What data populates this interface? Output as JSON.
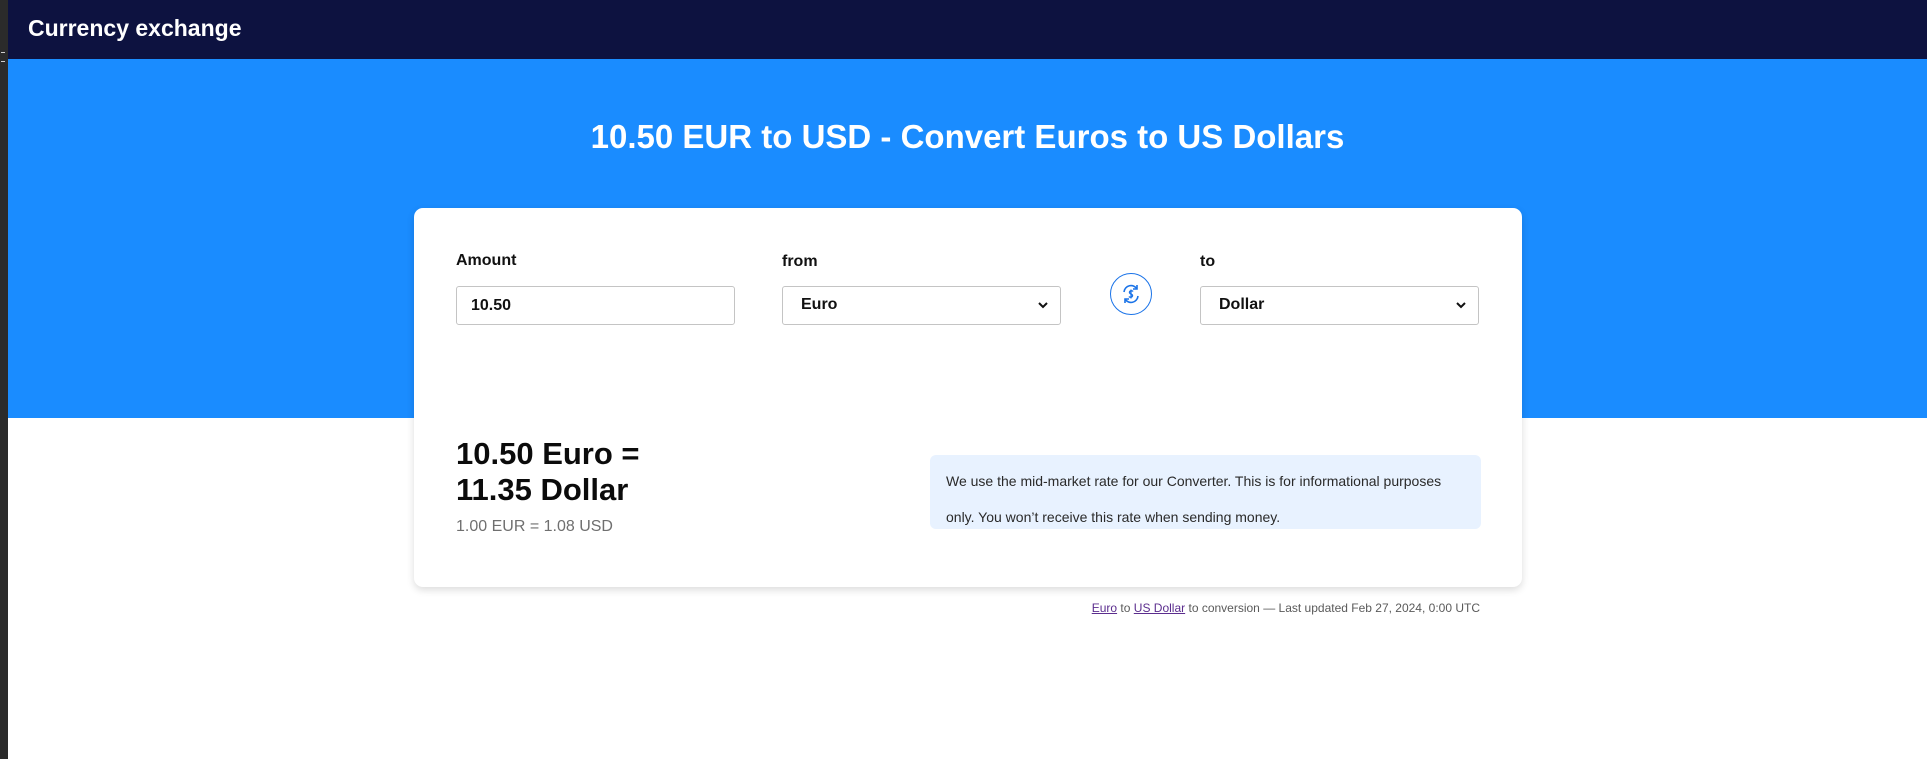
{
  "header": {
    "brand": "Currency exchange"
  },
  "hero": {
    "headline": "10.50 EUR to USD - Convert Euros to US Dollars"
  },
  "converter": {
    "amount_label": "Amount",
    "amount_value": "10.50",
    "from_label": "from",
    "from_value": "Euro",
    "to_label": "to",
    "to_value": "Dollar",
    "swap_icon": "currency-swap-icon"
  },
  "result": {
    "line1": "10.50 Euro =",
    "line2": "11.35 Dollar",
    "rate": "1.00 EUR = 1.08 USD"
  },
  "notice": {
    "text": "We use the mid-market rate for our Converter. This is for informational purposes only. You won’t receive this rate when sending money."
  },
  "footer": {
    "link_from": "Euro",
    "sep1": "to",
    "link_to": "US Dollar",
    "suffix": "to conversion — Last updated Feb 27, 2024, 0:00 UTC"
  },
  "colors": {
    "topbar": "#0d1240",
    "hero": "#1a8cff",
    "accent": "#1a73e8",
    "notice_bg": "#e8f2ff"
  }
}
